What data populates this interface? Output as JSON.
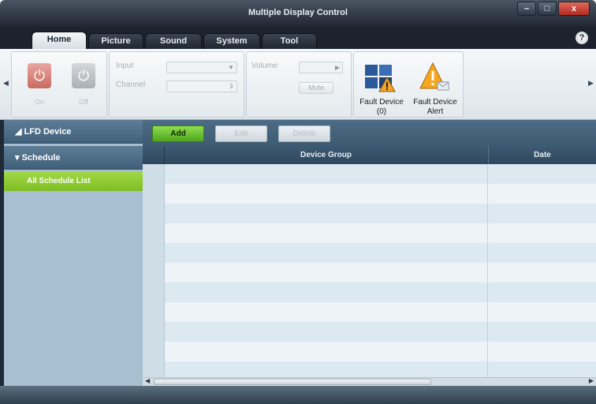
{
  "window": {
    "title": "Multiple Display Control",
    "controls": [
      "–",
      "□",
      "x"
    ]
  },
  "tabs": [
    {
      "label": "Home"
    },
    {
      "label": "Picture"
    },
    {
      "label": "Sound"
    },
    {
      "label": "System"
    },
    {
      "label": "Tool"
    }
  ],
  "help_glyph": "?",
  "ribbon": {
    "power_on_label": "On",
    "power_off_label": "Off",
    "input_label": "Input",
    "channel_label": "Channel",
    "volume_label": "Volume",
    "mute_label": "Mute",
    "fault_device_label": "Fault Device (0)",
    "fault_alert_label": "Fault Device Alert"
  },
  "sidebar": {
    "lfd_device": "LFD Device",
    "schedule": "Schedule",
    "all_schedule_list": "All Schedule List"
  },
  "toolbar": {
    "add": "Add",
    "edit": "Edit",
    "delete": "Delete"
  },
  "table": {
    "columns": [
      "Device Group",
      "Date"
    ],
    "row_count": 11
  }
}
